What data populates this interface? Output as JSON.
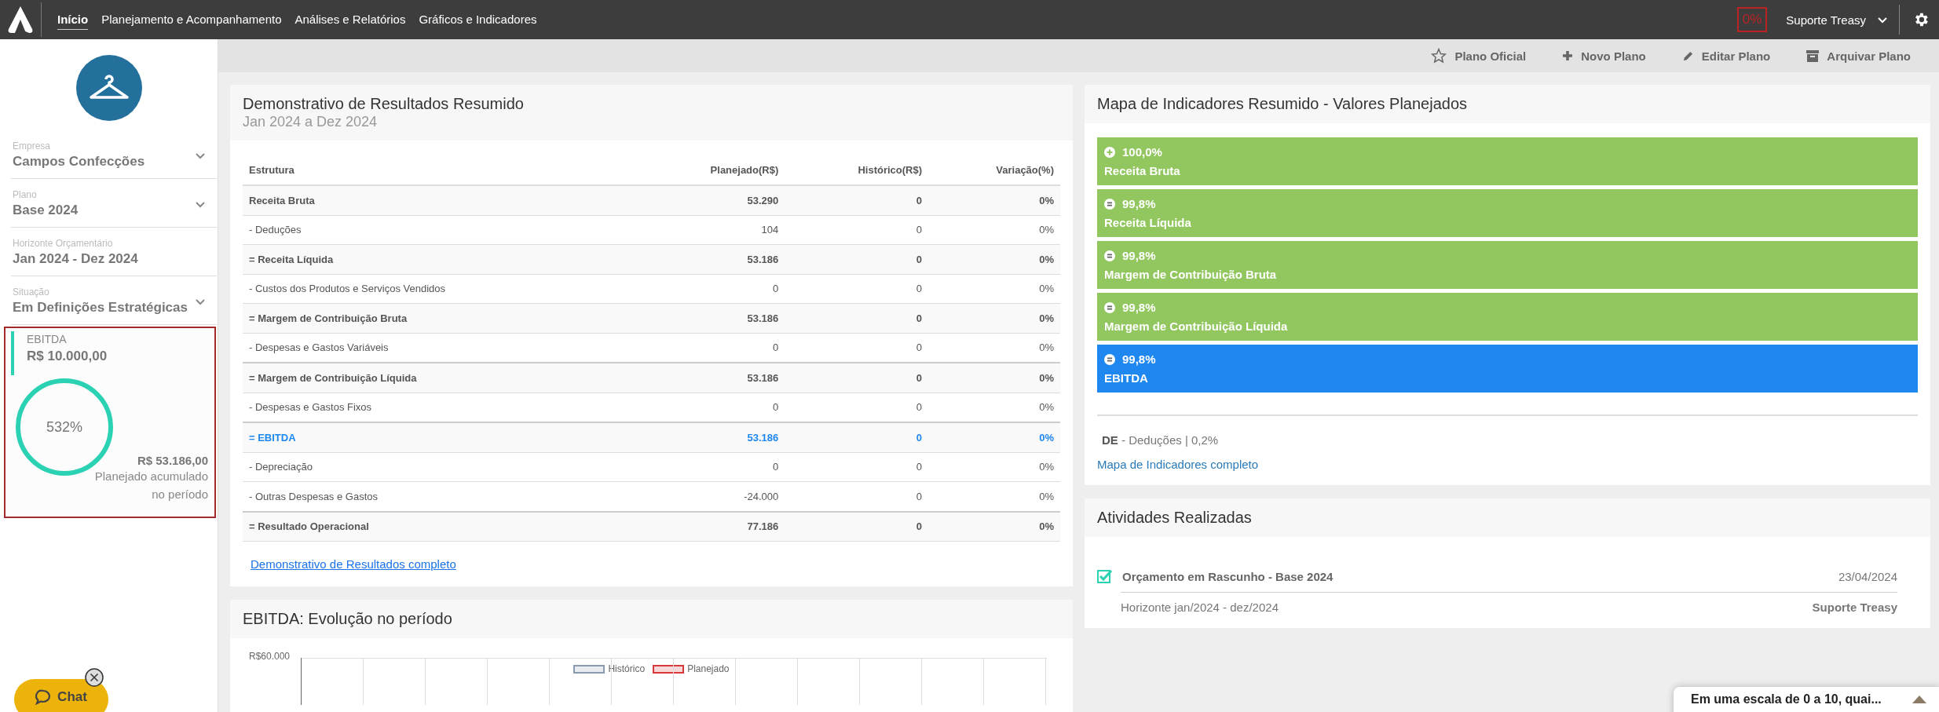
{
  "nav": {
    "items": [
      {
        "label": "Início",
        "selected": true
      },
      {
        "label": "Planejamento e Acompanhamento",
        "selected": false
      },
      {
        "label": "Análises e Relatórios",
        "selected": false
      },
      {
        "label": "Gráficos e Indicadores",
        "selected": false
      }
    ],
    "progress": "0%",
    "user": "Suporte Treasy"
  },
  "toolbar": [
    {
      "label": "Plano Oficial",
      "kind": "star"
    },
    {
      "label": "Novo Plano",
      "kind": "plus"
    },
    {
      "label": "Editar Plano",
      "kind": "pencil"
    },
    {
      "label": "Arquivar Plano",
      "kind": "archive"
    }
  ],
  "sidebar": {
    "fields": [
      {
        "label": "Empresa",
        "value": "Campos Confecções",
        "dropdown": true
      },
      {
        "label": "Plano",
        "value": "Base 2024",
        "dropdown": true
      },
      {
        "label": "Horizonte Orçamentário",
        "value": "Jan 2024 - Dez 2024",
        "dropdown": false
      },
      {
        "label": "Situação",
        "value": "Em Definições Estratégicas",
        "dropdown": true
      }
    ],
    "indicator": {
      "title": "EBITDA",
      "target": "R$ 10.000,00",
      "percent": "532%",
      "amount": "R$ 53.186,00",
      "caption": "Planejado acumulado no período"
    },
    "chat": "Chat"
  },
  "statement": {
    "title": "Demonstrativo de Resultados Resumido",
    "subtitle": "Jan 2024 a Dez 2024",
    "columns": [
      "Estrutura",
      "Planejado(R$)",
      "Histórico(R$)",
      "Variação(%)"
    ],
    "rows": [
      {
        "kind": "total",
        "cells": [
          "Receita Bruta",
          "53.290",
          "0",
          "0%"
        ]
      },
      {
        "kind": "item",
        "cells": [
          "- Deduções",
          "104",
          "0",
          "0%"
        ]
      },
      {
        "kind": "total",
        "cells": [
          "= Receita Líquida",
          "53.186",
          "0",
          "0%"
        ]
      },
      {
        "kind": "item",
        "cells": [
          "- Custos dos Produtos e Serviços Vendidos",
          "0",
          "0",
          "0%"
        ]
      },
      {
        "kind": "total",
        "cells": [
          "= Margem de Contribuição Bruta",
          "53.186",
          "0",
          "0%"
        ]
      },
      {
        "kind": "item",
        "cells": [
          "- Despesas e Gastos Variáveis",
          "0",
          "0",
          "0%"
        ]
      },
      {
        "kind": "total",
        "cells": [
          "= Margem de Contribuição Líquida",
          "53.186",
          "0",
          "0%"
        ]
      },
      {
        "kind": "item",
        "cells": [
          "- Despesas e Gastos Fixos",
          "0",
          "0",
          "0%"
        ]
      },
      {
        "kind": "highlight",
        "cells": [
          "= EBITDA",
          "53.186",
          "0",
          "0%"
        ]
      },
      {
        "kind": "item",
        "cells": [
          "- Depreciação",
          "0",
          "0",
          "0%"
        ]
      },
      {
        "kind": "item",
        "cells": [
          "- Outras Despesas e Gastos",
          "-24.000",
          "0",
          "0%"
        ]
      },
      {
        "kind": "total",
        "cells": [
          "= Resultado Operacional",
          "77.186",
          "0",
          "0%"
        ]
      }
    ],
    "link": "Demonstrativo de Resultados completo"
  },
  "evolution": {
    "title": "EBITDA: Evolução no período",
    "legend": [
      {
        "label": "Histórico",
        "color": "#8a9bb0"
      },
      {
        "label": "Planejado",
        "color": "#d9383a"
      }
    ],
    "ytick": "R$60.000"
  },
  "indicators": {
    "title": "Mapa de Indicadores Resumido - Valores Planejados",
    "items": [
      {
        "kind": "plus",
        "percent": "100,0%",
        "label": "Receita Bruta",
        "color": "#92c760"
      },
      {
        "kind": "equals",
        "percent": "99,8%",
        "label": "Receita Líquida",
        "color": "#92c760"
      },
      {
        "kind": "equals",
        "percent": "99,8%",
        "label": "Margem de Contribuição Bruta",
        "color": "#92c760"
      },
      {
        "kind": "equals",
        "percent": "99,8%",
        "label": "Margem de Contribuição Líquida",
        "color": "#92c760"
      },
      {
        "kind": "equals",
        "percent": "99,8%",
        "label": "EBITDA",
        "color": "#1e88f0"
      }
    ],
    "legend": "**DE** - Deduções | 0,2%",
    "link": "Mapa de Indicadores completo"
  },
  "activities": {
    "title": "Atividades Realizadas",
    "items": [
      {
        "checked": true,
        "title": "Orçamento em Rascunho - Base 2024",
        "date": "23/04/2024",
        "detail": "Horizonte jan/2024 - dez/2024",
        "user": "Suporte Treasy"
      }
    ]
  },
  "survey": "Em uma escala de 0 a 10, quai..."
}
